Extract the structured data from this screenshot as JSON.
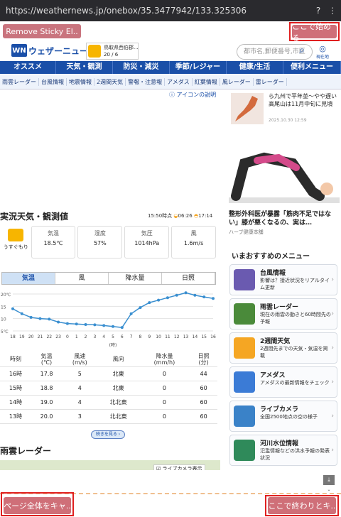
{
  "browser": {
    "url": "https://weathernews.jp/onebox/35.3477942/133.325306"
  },
  "overlay": {
    "remove_label": "Remove Sticky El..",
    "start_label": "ここで始める",
    "capture_label": "ページ全体をキャ..",
    "end_label": "ここで終わりとキ.."
  },
  "header": {
    "logo_mark": "WN",
    "logo_text": "ウェザーニュース",
    "wx_place": "鳥取県西伯郡...",
    "wx_temp": "20 / 6",
    "search_placeholder": "都市名,郵便番号,市区",
    "here_label": "現在地"
  },
  "nav": [
    "オススメ",
    "天気・観測",
    "防災・減災",
    "季節/レジャー",
    "健康/生活",
    "便利メニュー"
  ],
  "subnav": [
    "雨雲レーダー",
    "台風情報",
    "地震情報",
    "2週間天気",
    "警報・注意報",
    "アメダス",
    "紅葉情報",
    "風レーダー",
    "雷レーダー"
  ],
  "icon_link": "アイコンの説明",
  "obs": {
    "title": "実況天気・観測値",
    "time": "15:50時点",
    "sunrise": "06:26",
    "sunset": "17:14",
    "weather": "うすぐもり",
    "temp_label": "気温",
    "temp_val": "18.5℃",
    "hum_label": "湿度",
    "hum_val": "57%",
    "pres_label": "気圧",
    "pres_val": "1014hPa",
    "wind_label": "風",
    "wind_val": "1.6m/s"
  },
  "tabs": [
    "気温",
    "風",
    "降水量",
    "日照"
  ],
  "chart_data": {
    "type": "line",
    "categories": [
      "18",
      "19",
      "20",
      "21",
      "22",
      "23",
      "0",
      "1",
      "2",
      "3",
      "4",
      "5",
      "6",
      "7",
      "8",
      "9",
      "10",
      "11",
      "12",
      "13",
      "14",
      "15",
      "16"
    ],
    "values": [
      14,
      12,
      10.5,
      10,
      9.8,
      8.6,
      8,
      7.8,
      7.6,
      7.5,
      7.2,
      6.8,
      6.4,
      12,
      14.5,
      16.5,
      17.5,
      18.5,
      19.5,
      20.5,
      19.5,
      18.8,
      18.2
    ],
    "ylim": [
      5,
      20
    ],
    "yticks": [
      "20℃",
      "15",
      "10",
      "5℃"
    ],
    "xlabel": "(時)"
  },
  "table": {
    "headers": [
      "時刻",
      "気温\n(℃)",
      "風速\n(m/s)",
      "風向",
      "降水量\n(mm/h)",
      "日照\n(分)"
    ],
    "rows": [
      [
        "16時",
        "17.8",
        "5",
        "北東",
        "0",
        "44"
      ],
      [
        "15時",
        "18.8",
        "4",
        "北東",
        "0",
        "60"
      ],
      [
        "14時",
        "19.0",
        "4",
        "北北東",
        "0",
        "60"
      ],
      [
        "13時",
        "20.0",
        "3",
        "北北東",
        "0",
        "60"
      ]
    ]
  },
  "more_button": "続きを見る",
  "radar": {
    "title": "雨雲レーダー",
    "checkbox": "ライブカメラ表示"
  },
  "news": {
    "text": "ら九州で平年並〜やや遅い 高尾山は11月中旬に見頃",
    "date": "2025.10.30 12:59"
  },
  "ad": {
    "title": "整形外科医が暴露「筋肉不足ではない」膝が悪くなるの、実は…",
    "source": "ハーブ健康本舗"
  },
  "menu": {
    "heading": "いまおすすめのメニュー",
    "items": [
      {
        "title": "台風情報",
        "desc": "影響は？接近状況をリアルタイム更新",
        "color": "#6a5ab0"
      },
      {
        "title": "雨雲レーダー",
        "desc": "現在の雨雲の動きと60時間先の予報",
        "color": "#4a8a3a"
      },
      {
        "title": "2週間天気",
        "desc": "2週間先までの天気・気温を掲載",
        "color": "#f5a623"
      },
      {
        "title": "アメダス",
        "desc": "アメダスの最新情報をチェック",
        "color": "#3b7bd6"
      },
      {
        "title": "ライブカメラ",
        "desc": "全国2500地点の空の様子",
        "color": "#3a82c8"
      },
      {
        "title": "河川水位情報",
        "desc": "氾濫情報などの洪水予報の発表状況",
        "color": "#2f8a5a"
      }
    ]
  }
}
